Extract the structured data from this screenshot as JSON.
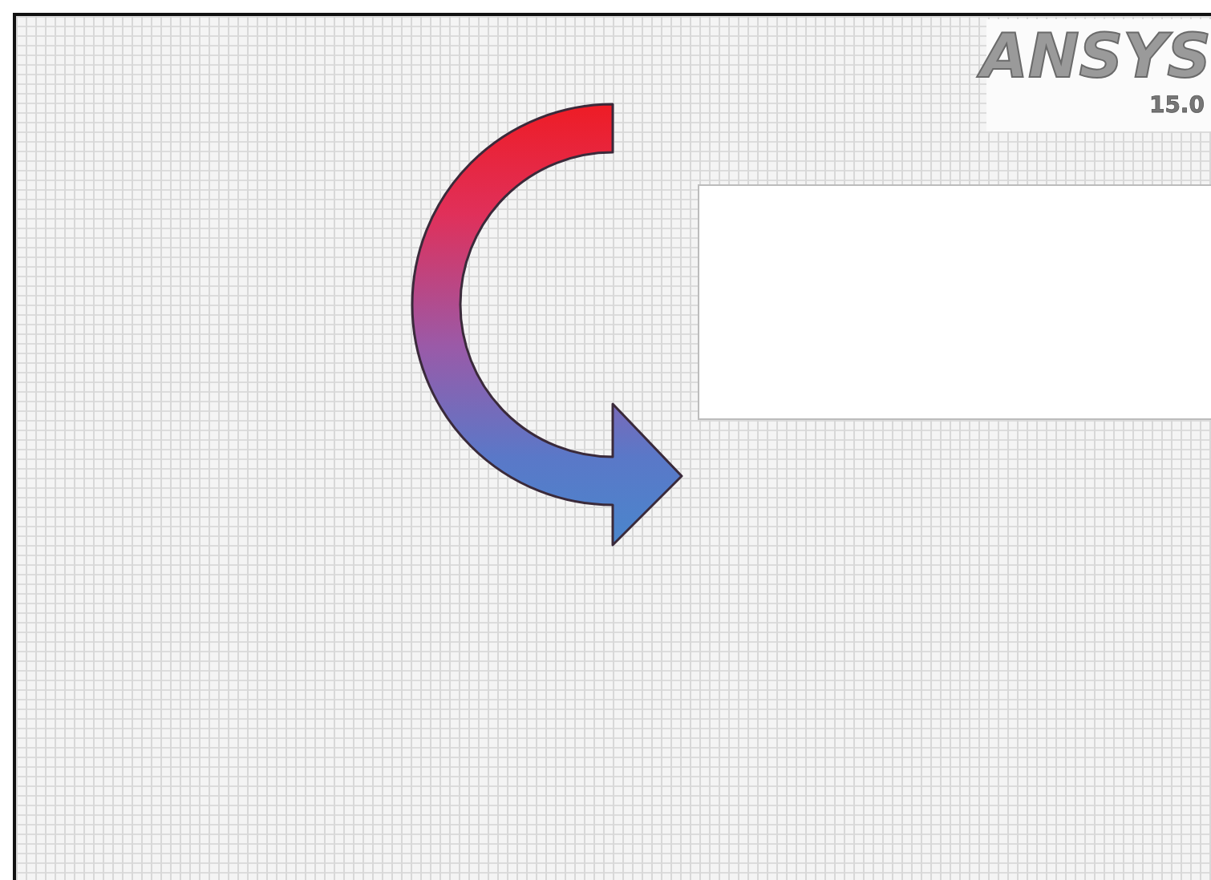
{
  "logo": {
    "name": "ANSYS",
    "version": "15.0"
  }
}
